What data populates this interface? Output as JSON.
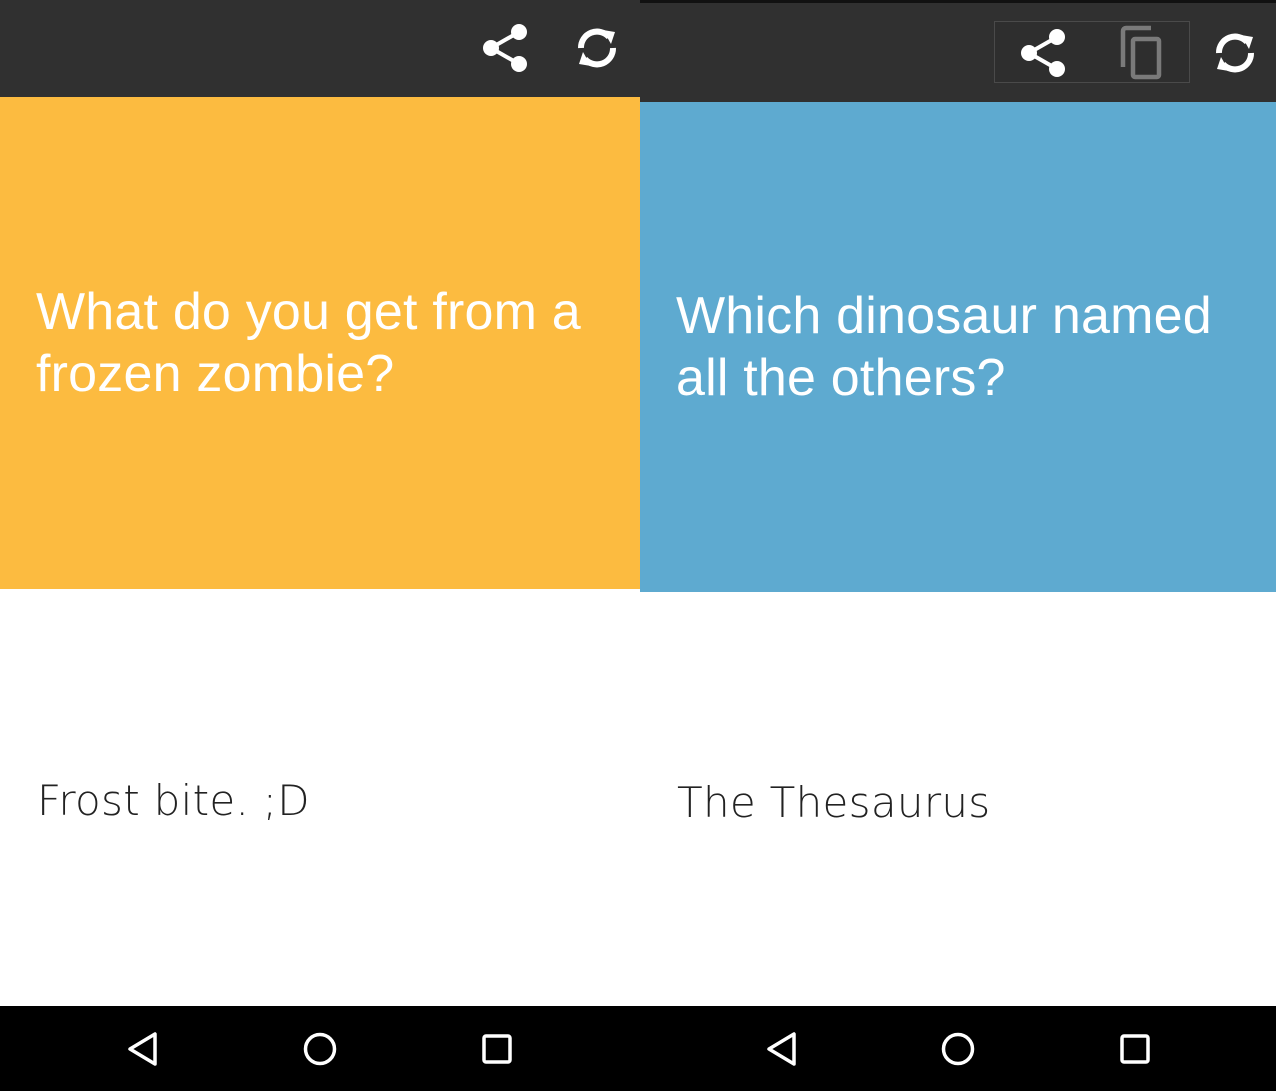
{
  "theme": {
    "appbar": "#303030",
    "navbar": "#000000",
    "icon": "#ffffff",
    "icon_dim": "#7a7a7a",
    "answer_text": "#222222"
  },
  "screens": [
    {
      "card_color": "#fcbb40",
      "question": "What do you get from a frozen zombie?",
      "answer": "Frost bite. ;D",
      "actions": [
        "share-icon",
        "refresh-icon"
      ]
    },
    {
      "card_color": "#5eaad0",
      "question": "Which dinosaur named all the others?",
      "answer": "The Thesaurus",
      "actions": [
        "share-icon",
        "copy-icon",
        "refresh-icon"
      ]
    }
  ],
  "nav_buttons": [
    "back-icon",
    "home-icon",
    "recents-icon"
  ]
}
